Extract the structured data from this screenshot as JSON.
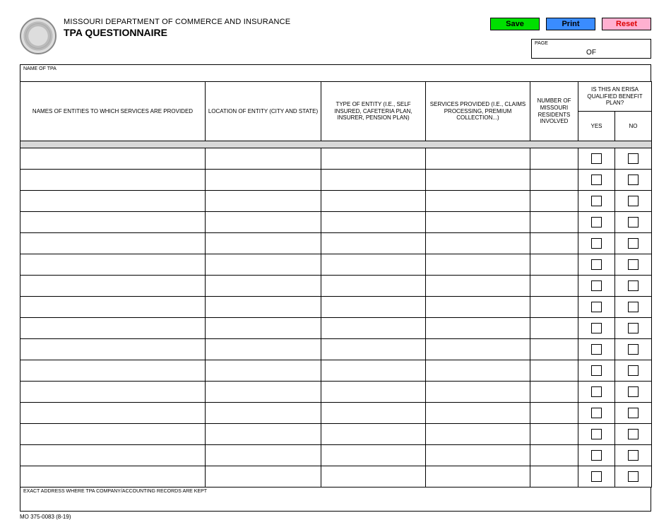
{
  "buttons": {
    "save": "Save",
    "print": "Print",
    "reset": "Reset"
  },
  "header": {
    "department": "MISSOURI DEPARTMENT OF COMMERCE AND INSURANCE",
    "title": "TPA QUESTIONNAIRE"
  },
  "pagebox": {
    "label": "PAGE",
    "of": "OF"
  },
  "name_of_tpa_label": "NAME OF TPA",
  "columns": {
    "c1": "NAMES OF ENTITIES TO WHICH SERVICES ARE PROVIDED",
    "c2": "LOCATION OF ENTITY (CITY AND STATE)",
    "c3": "TYPE OF ENTITY (I.E., SELF INSURED, CAFETERIA PLAN, INSURER, PENSION PLAN)",
    "c4": "SERVICES PROVIDED (I.E., CLAIMS PROCESSING, PREMIUM COLLECTION...)",
    "c5": "NUMBER OF MISSOURI RESIDENTS INVOLVED",
    "c6": "IS THIS AN ERISA QUALIFIED BENEFIT PLAN?",
    "yes": "YES",
    "no": "NO"
  },
  "rows": [
    {
      "name": "",
      "location": "",
      "type": "",
      "services": "",
      "residents": "",
      "yes": false,
      "no": false
    },
    {
      "name": "",
      "location": "",
      "type": "",
      "services": "",
      "residents": "",
      "yes": false,
      "no": false
    },
    {
      "name": "",
      "location": "",
      "type": "",
      "services": "",
      "residents": "",
      "yes": false,
      "no": false
    },
    {
      "name": "",
      "location": "",
      "type": "",
      "services": "",
      "residents": "",
      "yes": false,
      "no": false
    },
    {
      "name": "",
      "location": "",
      "type": "",
      "services": "",
      "residents": "",
      "yes": false,
      "no": false
    },
    {
      "name": "",
      "location": "",
      "type": "",
      "services": "",
      "residents": "",
      "yes": false,
      "no": false
    },
    {
      "name": "",
      "location": "",
      "type": "",
      "services": "",
      "residents": "",
      "yes": false,
      "no": false
    },
    {
      "name": "",
      "location": "",
      "type": "",
      "services": "",
      "residents": "",
      "yes": false,
      "no": false
    },
    {
      "name": "",
      "location": "",
      "type": "",
      "services": "",
      "residents": "",
      "yes": false,
      "no": false
    },
    {
      "name": "",
      "location": "",
      "type": "",
      "services": "",
      "residents": "",
      "yes": false,
      "no": false
    },
    {
      "name": "",
      "location": "",
      "type": "",
      "services": "",
      "residents": "",
      "yes": false,
      "no": false
    },
    {
      "name": "",
      "location": "",
      "type": "",
      "services": "",
      "residents": "",
      "yes": false,
      "no": false
    },
    {
      "name": "",
      "location": "",
      "type": "",
      "services": "",
      "residents": "",
      "yes": false,
      "no": false
    },
    {
      "name": "",
      "location": "",
      "type": "",
      "services": "",
      "residents": "",
      "yes": false,
      "no": false
    },
    {
      "name": "",
      "location": "",
      "type": "",
      "services": "",
      "residents": "",
      "yes": false,
      "no": false
    },
    {
      "name": "",
      "location": "",
      "type": "",
      "services": "",
      "residents": "",
      "yes": false,
      "no": false
    }
  ],
  "footer_label": "EXACT ADDRESS WHERE TPA COMPANY/ACCOUNTING RECORDS ARE KEPT",
  "form_number": "MO 375-0083 (8-19)"
}
